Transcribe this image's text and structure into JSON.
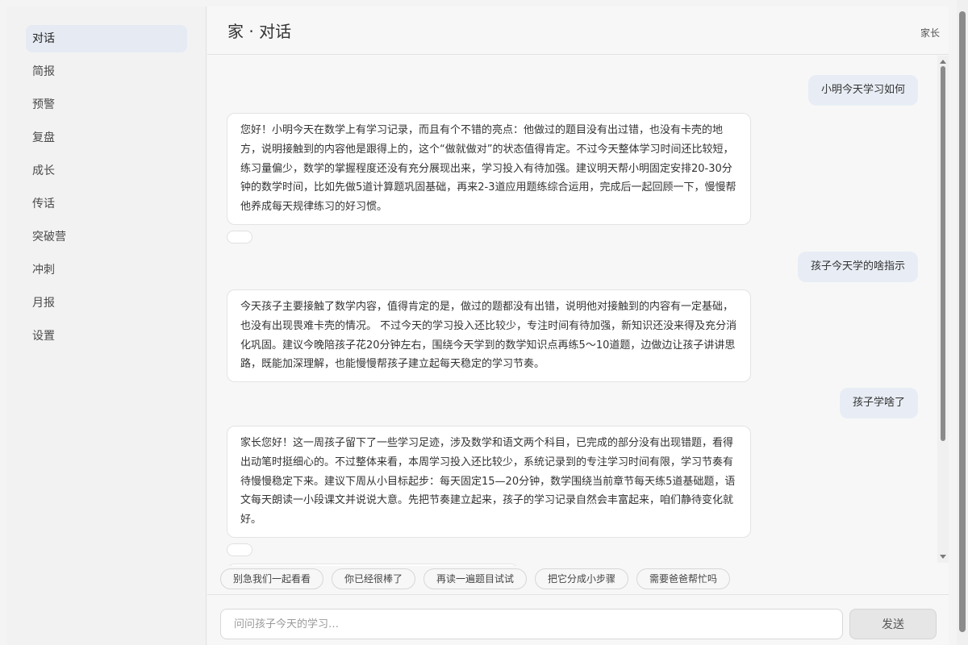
{
  "sidebar": {
    "items": [
      {
        "label": "对话"
      },
      {
        "label": "简报"
      },
      {
        "label": "预警"
      },
      {
        "label": "复盘"
      },
      {
        "label": "成长"
      },
      {
        "label": "传话"
      },
      {
        "label": "突破营"
      },
      {
        "label": "冲刺"
      },
      {
        "label": "月报"
      },
      {
        "label": "设置"
      }
    ]
  },
  "header": {
    "title": "家 · 对话",
    "user": "家长"
  },
  "chat": {
    "messages": [
      {
        "role": "user",
        "text": "小明今天学习如何"
      },
      {
        "role": "assistant",
        "text": "您好！小明今天在数学上有学习记录，而且有个不错的亮点：他做过的题目没有出过错，也没有卡壳的地方，说明接触到的内容他是跟得上的，这个“做就做对”的状态值得肯定。不过今天整体学习时间还比较短，练习量偏少，数学的掌握程度还没有充分展现出来，学习投入有待加强。建议明天帮小明固定安排20-30分钟的数学时间，比如先做5道计算题巩固基础，再来2-3道应用题练综合运用，完成后一起回顾一下，慢慢帮他养成每天规律练习的好习惯。"
      },
      {
        "role": "user",
        "text": "孩子今天学的啥指示"
      },
      {
        "role": "assistant",
        "text": "今天孩子主要接触了数学内容，值得肯定的是，做过的题都没有出错，说明他对接触到的内容有一定基础，也没有出现畏难卡壳的情况。 不过今天的学习投入还比较少，专注时间有待加强，新知识还没来得及充分消化巩固。建议今晚陪孩子花20分钟左右，围绕今天学到的数学知识点再练5～10道题，边做边让孩子讲讲思路，既能加深理解，也能慢慢帮孩子建立起每天稳定的学习节奏。"
      },
      {
        "role": "user",
        "text": "孩子学啥了"
      },
      {
        "role": "assistant",
        "text": "家长您好！这一周孩子留下了一些学习足迹，涉及数学和语文两个科目，已完成的部分没有出现错题，看得出动笔时挺细心的。不过整体来看，本周学习投入还比较少，系统记录到的专注学习时间有限，学习节奏有待慢慢稳定下来。建议下周从小目标起步：每天固定15—20分钟，数学围绕当前章节每天练5道基础题，语文每天朗读一小段课文并说说大意。先把节奏建立起来，孩子的学习记录自然会丰富起来，咱们静待变化就好。"
      }
    ]
  },
  "suggestions": [
    "别急我们一起看看",
    "你已经很棒了",
    "再读一遍题目试试",
    "把它分成小步骤",
    "需要爸爸帮忙吗"
  ],
  "composer": {
    "placeholder": "问问孩子今天的学习…",
    "send_label": "发送"
  }
}
